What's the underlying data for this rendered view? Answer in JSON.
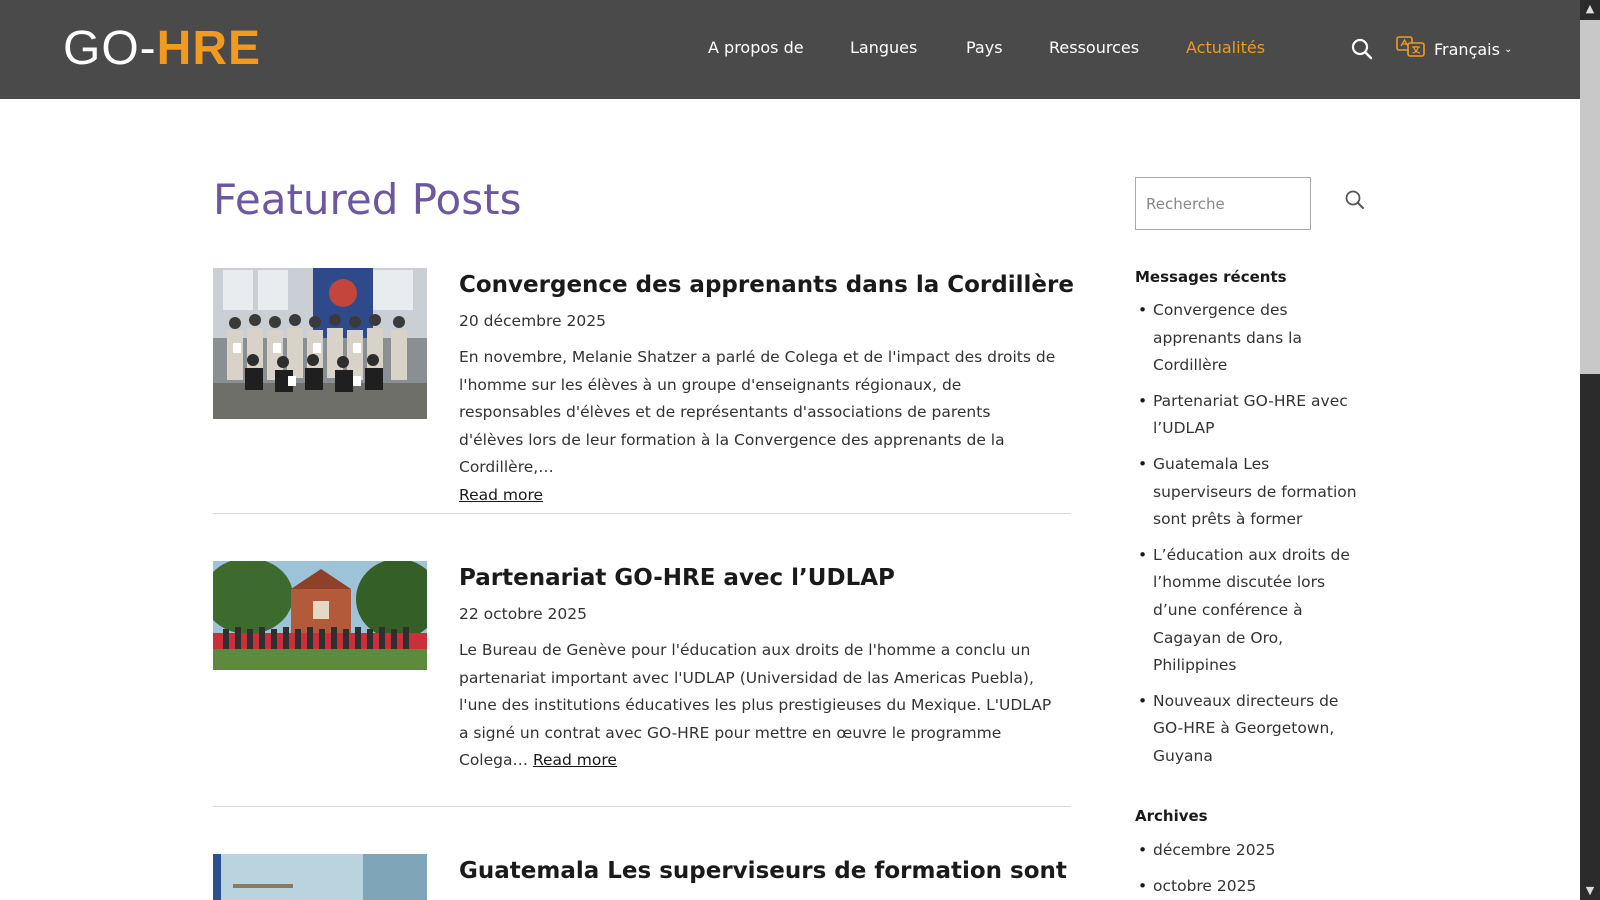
{
  "header": {
    "logo_part1": "GO-",
    "logo_part2": "HRE",
    "nav": [
      {
        "label": "A propos de"
      },
      {
        "label": "Langues"
      },
      {
        "label": "Pays"
      },
      {
        "label": "Ressources"
      },
      {
        "label": "Actualités",
        "active": true
      }
    ],
    "language": "Français"
  },
  "main": {
    "title": "Featured Posts",
    "posts": [
      {
        "title": "Convergence des apprenants dans la Cordillère",
        "date": "20 décembre 2025",
        "excerpt": "En novembre, Melanie Shatzer a parlé de Colega et de l'impact des droits de l'homme sur les élèves à un groupe d'enseignants régionaux, de responsables d'élèves et de représentants d'associations de parents d'élèves lors de leur formation à la Convergence des apprenants de la Cordillère,…",
        "read_more": "Read more"
      },
      {
        "title": "Partenariat GO-HRE avec l’UDLAP",
        "date": "22 octobre 2025",
        "excerpt": "Le Bureau de Genève pour l'éducation aux droits de l'homme a conclu un partenariat important avec l'UDLAP (Universidad de las Americas Puebla), l'une des institutions éducatives les plus prestigieuses du Mexique. L'UDLAP a signé un contrat avec GO-HRE pour mettre en œuvre le programme Colega…",
        "read_more": "Read more"
      },
      {
        "title": "Guatemala Les superviseurs de formation sont"
      }
    ]
  },
  "sidebar": {
    "search_placeholder": "Recherche",
    "recent_heading": "Messages récents",
    "recent": [
      "Convergence des apprenants dans la Cordillère",
      "Partenariat GO-HRE avec l’UDLAP",
      "Guatemala Les superviseurs de formation sont prêts à former",
      "L’éducation aux droits de l’homme discutée lors d’une conférence à Cagayan de Oro, Philippines",
      "Nouveaux directeurs de GO-HRE à Georgetown, Guyana"
    ],
    "archives_heading": "Archives",
    "archives": [
      "décembre 2025",
      "octobre 2025"
    ]
  },
  "colors": {
    "header_bg": "#4a4a4a",
    "accent_orange": "#f29a1f",
    "title_purple": "#6d58a0"
  }
}
